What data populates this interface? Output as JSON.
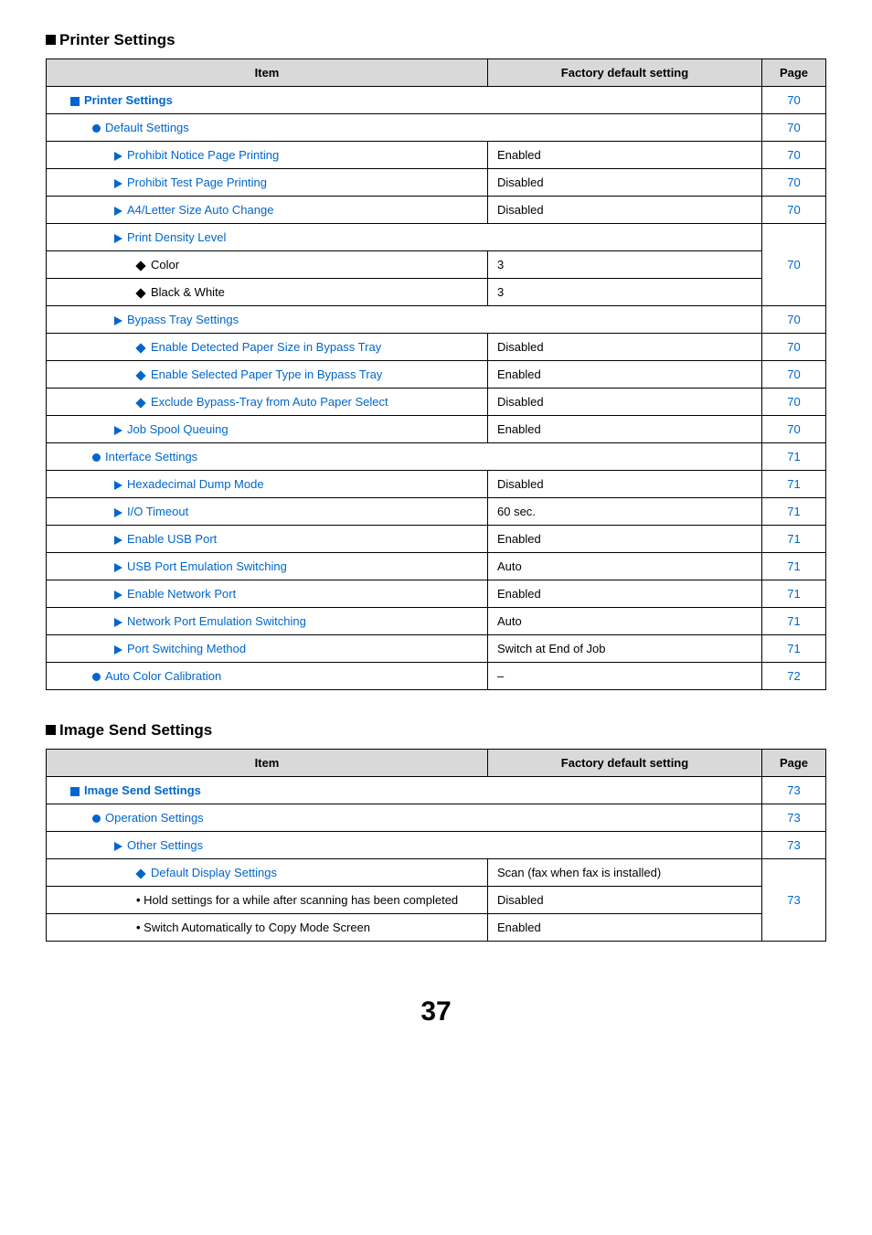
{
  "pageNumber": "37",
  "sections": [
    {
      "title": "Printer Settings",
      "headers": {
        "item": "Item",
        "factory": "Factory default setting",
        "page": "Page"
      },
      "rows": [
        {
          "indent": 1,
          "marker": "square-blue",
          "link": true,
          "label": "Printer Settings",
          "factory": null,
          "colspan": true,
          "page": "70",
          "bold": true
        },
        {
          "indent": 2,
          "marker": "circle",
          "link": true,
          "label": "Default Settings",
          "factory": null,
          "colspan": true,
          "page": "70"
        },
        {
          "indent": 3,
          "marker": "tri",
          "link": true,
          "label": "Prohibit Notice Page Printing",
          "factory": "Enabled",
          "page": "70"
        },
        {
          "indent": 3,
          "marker": "tri",
          "link": true,
          "label": "Prohibit Test Page Printing",
          "factory": "Disabled",
          "page": "70"
        },
        {
          "indent": 3,
          "marker": "tri",
          "link": true,
          "label": "A4/Letter Size Auto Change",
          "factory": "Disabled",
          "page": "70"
        },
        {
          "indent": 3,
          "marker": "tri",
          "link": true,
          "label": "Print Density Level",
          "factory": null,
          "colspan": true,
          "page": null,
          "rowspan_start": 3
        },
        {
          "indent": 4,
          "marker": "diamond-blk",
          "link": false,
          "label": "Color",
          "factory": "3",
          "page": "70",
          "rowspan_mid": true
        },
        {
          "indent": 4,
          "marker": "diamond-blk",
          "link": false,
          "label": "Black & White",
          "factory": "3",
          "page": null,
          "rowspan_mid": true
        },
        {
          "indent": 3,
          "marker": "tri",
          "link": true,
          "label": "Bypass Tray Settings",
          "factory": null,
          "colspan": true,
          "page": "70"
        },
        {
          "indent": 4,
          "marker": "diamond",
          "link": true,
          "label": "Enable Detected Paper Size in Bypass Tray",
          "factory": "Disabled",
          "page": "70"
        },
        {
          "indent": 4,
          "marker": "diamond",
          "link": true,
          "label": "Enable Selected Paper Type in Bypass Tray",
          "factory": "Enabled",
          "page": "70"
        },
        {
          "indent": 4,
          "marker": "diamond",
          "link": true,
          "label": "Exclude Bypass-Tray from Auto Paper Select",
          "factory": "Disabled",
          "page": "70"
        },
        {
          "indent": 3,
          "marker": "tri",
          "link": true,
          "label": "Job Spool Queuing",
          "factory": "Enabled",
          "page": "70"
        },
        {
          "indent": 2,
          "marker": "circle",
          "link": true,
          "label": "Interface Settings",
          "factory": null,
          "colspan": true,
          "page": "71"
        },
        {
          "indent": 3,
          "marker": "tri",
          "link": true,
          "label": "Hexadecimal Dump Mode",
          "factory": "Disabled",
          "page": "71"
        },
        {
          "indent": 3,
          "marker": "tri",
          "link": true,
          "label": "I/O Timeout",
          "factory": "60 sec.",
          "page": "71"
        },
        {
          "indent": 3,
          "marker": "tri",
          "link": true,
          "label": "Enable USB Port",
          "factory": "Enabled",
          "page": "71"
        },
        {
          "indent": 3,
          "marker": "tri",
          "link": true,
          "label": "USB Port Emulation Switching",
          "factory": "Auto",
          "page": "71"
        },
        {
          "indent": 3,
          "marker": "tri",
          "link": true,
          "label": "Enable Network Port",
          "factory": "Enabled",
          "page": "71"
        },
        {
          "indent": 3,
          "marker": "tri",
          "link": true,
          "label": "Network Port Emulation Switching",
          "factory": "Auto",
          "page": "71"
        },
        {
          "indent": 3,
          "marker": "tri",
          "link": true,
          "label": "Port Switching Method",
          "factory": "Switch at End of Job",
          "page": "71"
        },
        {
          "indent": 2,
          "marker": "circle",
          "link": true,
          "label": "Auto Color Calibration",
          "factory": "–",
          "page": "72"
        }
      ]
    },
    {
      "title": "Image Send Settings",
      "headers": {
        "item": "Item",
        "factory": "Factory default setting",
        "page": "Page"
      },
      "rows": [
        {
          "indent": 1,
          "marker": "square-blue",
          "link": true,
          "label": "Image Send Settings",
          "factory": null,
          "colspan": true,
          "page": "73",
          "bold": true
        },
        {
          "indent": 2,
          "marker": "circle",
          "link": true,
          "label": "Operation Settings",
          "factory": null,
          "colspan": true,
          "page": "73"
        },
        {
          "indent": 3,
          "marker": "tri",
          "link": true,
          "label": "Other Settings",
          "factory": null,
          "colspan": true,
          "page": "73"
        },
        {
          "indent": 4,
          "marker": "diamond",
          "link": true,
          "label": "Default Display Settings",
          "factory": "Scan (fax when fax is installed)",
          "page": null,
          "rowspan_start": 3
        },
        {
          "indent": 4,
          "marker": "dot",
          "link": false,
          "label": "Hold settings for a while after scanning has been completed",
          "factory": "Disabled",
          "page": "73",
          "rowspan_mid": true
        },
        {
          "indent": 4,
          "marker": "dot",
          "link": false,
          "label": "Switch Automatically to Copy Mode Screen",
          "factory": "Enabled",
          "page": null,
          "rowspan_mid": true
        }
      ]
    }
  ]
}
